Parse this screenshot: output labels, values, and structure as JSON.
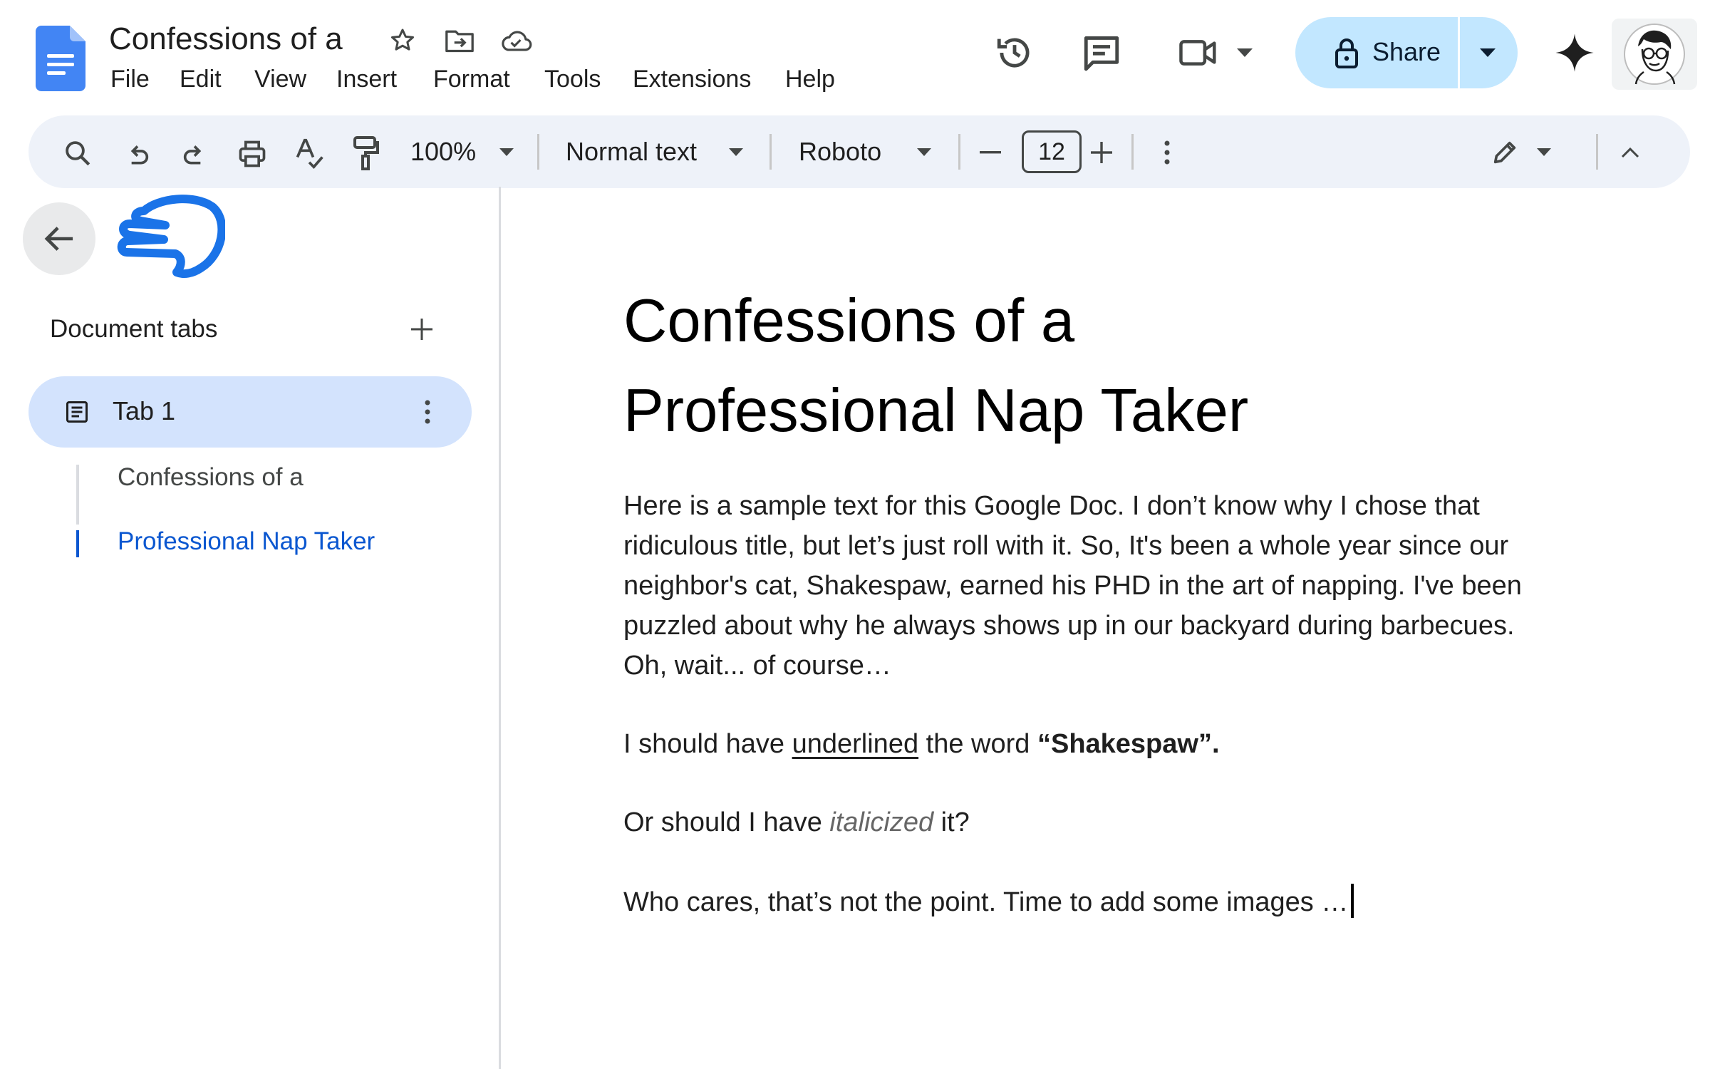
{
  "header": {
    "doc_title": "Confessions of a",
    "menu": [
      "File",
      "Edit",
      "View",
      "Insert",
      "Format",
      "Tools",
      "Extensions",
      "Help"
    ],
    "share_label": "Share",
    "icons": [
      "google-docs-logo-icon",
      "star-icon",
      "move-to-folder-icon",
      "cloud-saved-icon",
      "version-history-icon",
      "comments-icon",
      "meet-video-icon",
      "lock-icon",
      "gemini-sparkle-icon"
    ]
  },
  "toolbar": {
    "zoom": "100%",
    "style": "Normal text",
    "font": "Roboto",
    "font_size": "12",
    "icons": [
      "search-icon",
      "undo-icon",
      "redo-icon",
      "print-icon",
      "spellcheck-icon",
      "paint-format-icon",
      "decrease-font-icon",
      "increase-font-icon",
      "more-options-icon",
      "edit-mode-pencil-icon",
      "collapse-toolbar-icon"
    ]
  },
  "sidebar": {
    "heading": "Document tabs",
    "tab_label": "Tab 1",
    "outline": [
      "Confessions of a",
      "Professional Nap Taker"
    ]
  },
  "document": {
    "heading_line1": "Confessions of a",
    "heading_line2": "Professional Nap Taker",
    "paragraph1": "Here is a sample text for this Google Doc. I don’t know why I chose that ridiculous title, but let’s just roll with it. So, It's been a whole year since our neighbor's cat, Shakespaw, earned his PHD in the art of napping. I've been puzzled about why he always shows up in our backyard during barbecues. Oh, wait... of course…",
    "p2_part1": "I should have ",
    "p2_underlined": "underlined",
    "p2_part2": " the word ",
    "p2_bold": "“Shakespaw”.",
    "p3_part1": "Or should I have ",
    "p3_italic": "italicized",
    "p3_part2": " it?",
    "paragraph4": "Who cares, that’s not the point. Time to add some images …"
  },
  "colors": {
    "docs_blue": "#4285f4",
    "share_bg": "#c2e7ff",
    "toolbar_bg": "#eef2f9",
    "active_tab_bg": "#d3e3fd",
    "link_blue": "#0b57d0"
  }
}
